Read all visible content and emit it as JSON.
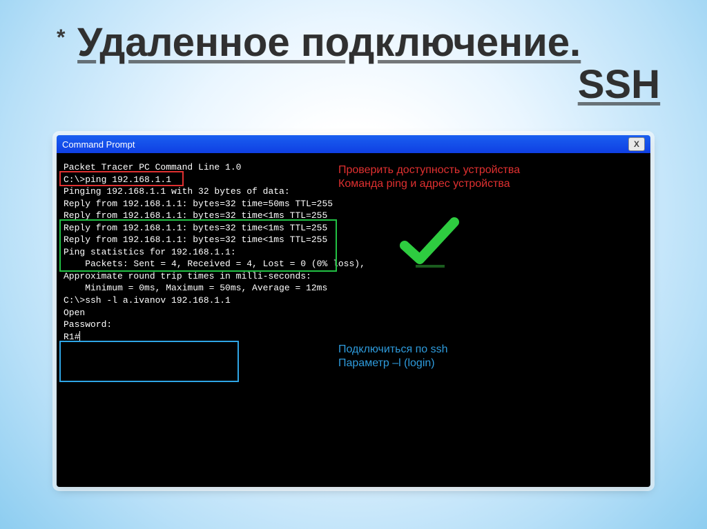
{
  "slide": {
    "bullet": "*",
    "title_line1": "Удаленное подключение.",
    "title_line2": "SSH"
  },
  "window": {
    "title": "Command Prompt",
    "close_label": "X"
  },
  "console": {
    "line01": "Packet Tracer PC Command Line 1.0",
    "line02": "C:\\>ping 192.168.1.1",
    "line03": "",
    "line04": "Pinging 192.168.1.1 with 32 bytes of data:",
    "line05": "",
    "line06": "Reply from 192.168.1.1: bytes=32 time=50ms TTL=255",
    "line07": "Reply from 192.168.1.1: bytes=32 time<1ms TTL=255",
    "line08": "Reply from 192.168.1.1: bytes=32 time<1ms TTL=255",
    "line09": "Reply from 192.168.1.1: bytes=32 time<1ms TTL=255",
    "line10": "",
    "line11": "Ping statistics for 192.168.1.1:",
    "line12": "    Packets: Sent = 4, Received = 4, Lost = 0 (0% loss),",
    "line13": "Approximate round trip times in milli-seconds:",
    "line14": "    Minimum = 0ms, Maximum = 50ms, Average = 12ms",
    "line15": "",
    "line16": "C:\\>ssh -l a.ivanov 192.168.1.1",
    "line17": "Open",
    "line18": "Password:",
    "line19": "",
    "line20": "",
    "line21": "R1#"
  },
  "annotations": {
    "red1": "Проверить доступность устройства",
    "red2": "Команда ping и адрес устройства",
    "blue1": "Подключиться по ssh",
    "blue2": "Параметр –l (login)"
  }
}
